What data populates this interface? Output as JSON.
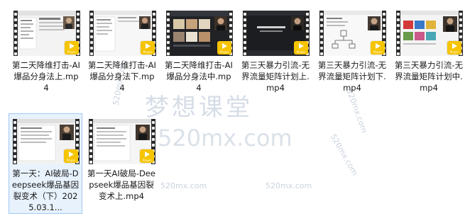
{
  "files": [
    {
      "name": "第二天降维打击-AI爆品分身法上.mp4",
      "badge": "Player"
    },
    {
      "name": "第二天降维打击-AI爆品分身法下.mp4",
      "badge": "Player"
    },
    {
      "name": "第二天降维打击-AI爆品分身法中.mp4",
      "badge": "Player"
    },
    {
      "name": "第三天暴力引流-无界流量矩阵计划上.mp4",
      "badge": "Player"
    },
    {
      "name": "第三天暴力引流-无界流量矩阵计划下.mp4",
      "badge": "Player"
    },
    {
      "name": "第三天暴力引流-无界流量矩阵计划中.mp4",
      "badge": "Player"
    },
    {
      "name": "第一天：AI破局-Deepseek爆品基因裂变术（下）2025.03.1...",
      "badge": "Player"
    },
    {
      "name": "第一天AI破局-Deepseek爆品基因裂变术上.mp4",
      "badge": "Player"
    }
  ],
  "watermarks": {
    "brand_cn": "梦想课堂",
    "brand_num": "520mx.com",
    "small_1": "520mx.com",
    "small_2": "520mx.com",
    "small_3": "520mx.com",
    "small_4": "520mx.com",
    "small_5": "520mx.com"
  }
}
